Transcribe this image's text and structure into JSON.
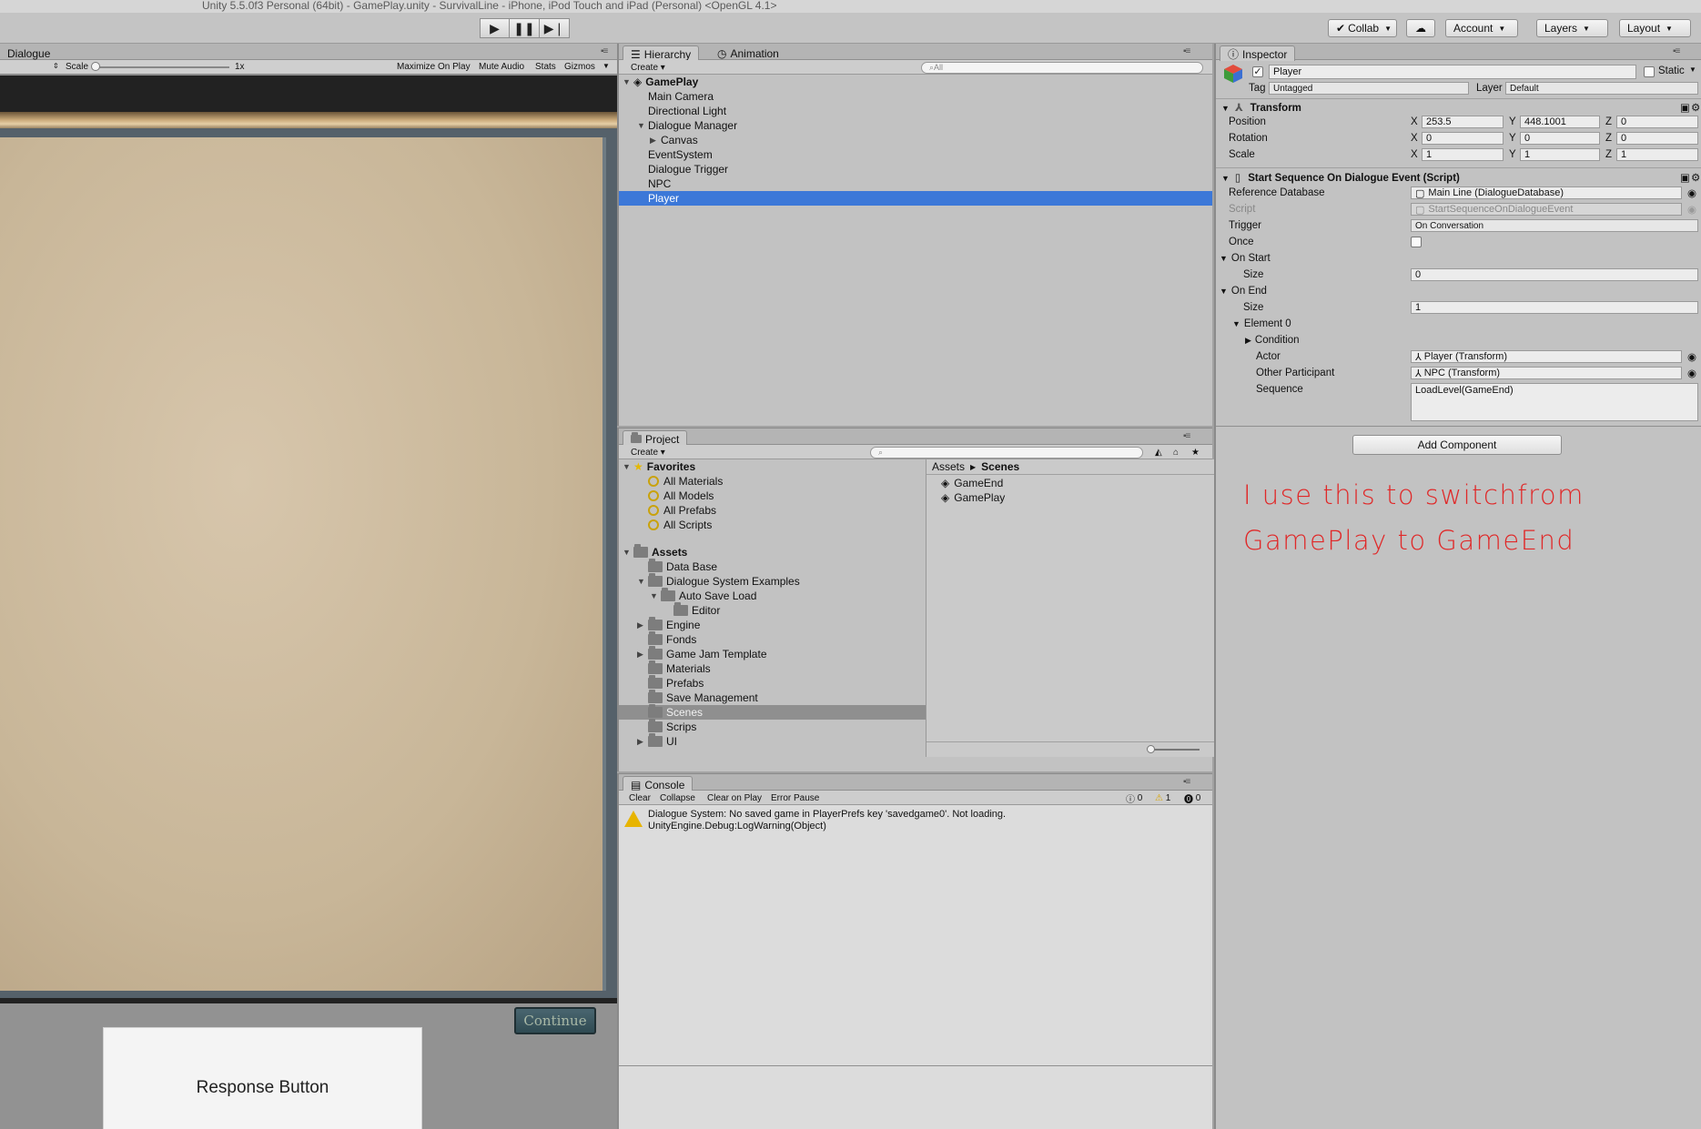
{
  "window": {
    "title": "Unity 5.5.0f3 Personal (64bit) - GamePlay.unity - SurvivalLine - iPhone, iPod Touch and iPad (Personal) <OpenGL 4.1>"
  },
  "toolbar": {
    "collab_label": "Collab",
    "account_label": "Account",
    "layers_label": "Layers",
    "layout_label": "Layout"
  },
  "game_view": {
    "tab_label": "Dialogue",
    "scale_label": "Scale",
    "scale_value": "1x",
    "maximize_label": "Maximize On Play",
    "mute_label": "Mute Audio",
    "stats_label": "Stats",
    "gizmos_label": "Gizmos",
    "continue_label": "Continue",
    "response_label": "Response Button"
  },
  "hierarchy": {
    "tab_label": "Hierarchy",
    "animation_tab_label": "Animation",
    "create_label": "Create",
    "search_placeholder": "All",
    "scene_name": "GamePlay",
    "items": [
      {
        "label": "Main Camera"
      },
      {
        "label": "Directional Light"
      },
      {
        "label": "Dialogue Manager"
      },
      {
        "label": "Canvas"
      },
      {
        "label": "EventSystem"
      },
      {
        "label": "Dialogue Trigger"
      },
      {
        "label": "NPC"
      },
      {
        "label": "Player"
      }
    ]
  },
  "project": {
    "tab_label": "Project",
    "create_label": "Create",
    "favorites_label": "Favorites",
    "favorites": [
      "All Materials",
      "All Models",
      "All Prefabs",
      "All Scripts"
    ],
    "assets_label": "Assets",
    "folders": [
      "Data Base",
      "Dialogue System Examples",
      "Auto Save Load",
      "Editor",
      "Engine",
      "Fonds",
      "Game Jam Template",
      "Materials",
      "Prefabs",
      "Save Management",
      "Scenes",
      "Scrips",
      "UI"
    ],
    "breadcrumb_root": "Assets",
    "breadcrumb_current": "Scenes",
    "files": [
      "GameEnd",
      "GamePlay"
    ]
  },
  "console": {
    "tab_label": "Console",
    "clear_label": "Clear",
    "collapse_label": "Collapse",
    "clear_on_play_label": "Clear on Play",
    "error_pause_label": "Error Pause",
    "info_count": "0",
    "warn_count": "1",
    "error_count": "0",
    "message_line1": "Dialogue System: No saved game in PlayerPrefs key 'savedgame0'. Not loading.",
    "message_line2": "UnityEngine.Debug:LogWarning(Object)"
  },
  "inspector": {
    "tab_label": "Inspector",
    "object_name": "Player",
    "static_label": "Static",
    "tag_label": "Tag",
    "tag_value": "Untagged",
    "layer_label": "Layer",
    "layer_value": "Default",
    "transform_title": "Transform",
    "position_label": "Position",
    "rotation_label": "Rotation",
    "scale_label": "Scale",
    "axis_x": "X",
    "axis_y": "Y",
    "axis_z": "Z",
    "position": {
      "x": "253.5",
      "y": "448.1001",
      "z": "0"
    },
    "rotation": {
      "x": "0",
      "y": "0",
      "z": "0"
    },
    "scale": {
      "x": "1",
      "y": "1",
      "z": "1"
    },
    "script_title": "Start Sequence On Dialogue Event (Script)",
    "reference_db_label": "Reference Database",
    "reference_db_value": "Main Line (DialogueDatabase)",
    "script_label": "Script",
    "script_value": "StartSequenceOnDialogueEvent",
    "trigger_label": "Trigger",
    "trigger_value": "On Conversation",
    "once_label": "Once",
    "on_start_label": "On Start",
    "size_label": "Size",
    "on_start_size": "0",
    "on_end_label": "On End",
    "on_end_size": "1",
    "element_label": "Element 0",
    "condition_label": "Condition",
    "actor_label": "Actor",
    "actor_value": "Player (Transform)",
    "other_label": "Other Participant",
    "other_value": "NPC (Transform)",
    "sequence_label": "Sequence",
    "sequence_value": "LoadLevel(GameEnd)",
    "add_component_label": "Add Component"
  },
  "annotation": {
    "line1": "I use this to switchfrom",
    "line2": "GamePlay to GameEnd",
    "color": "#e02828"
  }
}
